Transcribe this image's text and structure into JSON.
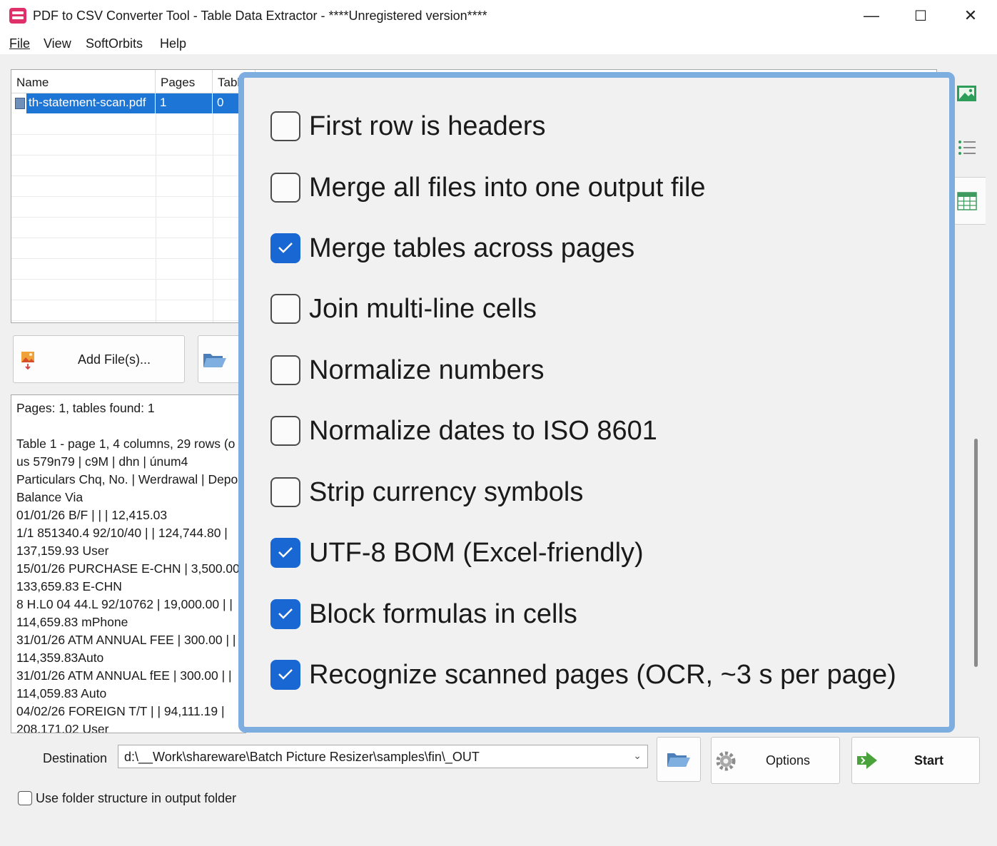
{
  "window": {
    "title": "PDF to CSV Converter Tool - Table Data Extractor - ****Unregistered version****",
    "minimize": "—",
    "maximize": "☐",
    "close": "✕"
  },
  "menu": [
    "File",
    "View",
    "SoftOrbits",
    "Help"
  ],
  "file_list": {
    "columns": [
      "Name",
      "Pages",
      "Tabl"
    ],
    "rows": [
      {
        "name": "th-statement-scan.pdf",
        "pages": "1",
        "tables": "0"
      }
    ]
  },
  "buttons": {
    "add_files": "Add File(s)...",
    "options": "Options",
    "start": "Start"
  },
  "log": {
    "lines": [
      "Pages: 1, tables found: 1",
      "",
      "Table 1 - page 1, 4 columns, 29 rows (o",
      "us 579n79 | c9M | dhn | únum4",
      "Particulars Chq, No. | Werdrawal | Depos",
      "Balance Via",
      "01/01/26 B/F |  |  | 12,415.03",
      "1/1 851340.4 92/10/40 |  | 124,744.80 |",
      "137,159.93 User",
      "15/01/26 PURCHASE E-CHN | 3,500.00",
      "133,659.83 E-CHN",
      "8 H.L0 04 44.L 92/10762 | 19,000.00 |  |",
      "114,659.83 mPhone",
      "31/01/26 ATM ANNUAL FEE | 300.00 |  |",
      "114,359.83Auto",
      "31/01/26 ATM ANNUAL fEE | 300.00 |  |",
      "114,059.83 Auto",
      "04/02/26 FOREIGN T/T |  | 94,111.19 |",
      "208,171.02 User"
    ]
  },
  "destination": {
    "label": "Destination",
    "value": "d:\\__Work\\shareware\\Batch Picture Resizer\\samples\\fin\\_OUT"
  },
  "folder_structure": {
    "label": "Use folder structure in output folder",
    "checked": false
  },
  "options": [
    {
      "label": "First row is headers",
      "checked": false
    },
    {
      "label": "Merge all files into one output file",
      "checked": false
    },
    {
      "label": "Merge tables across pages",
      "checked": true
    },
    {
      "label": "Join multi-line cells",
      "checked": false
    },
    {
      "label": "Normalize numbers",
      "checked": false
    },
    {
      "label": "Normalize dates to ISO 8601",
      "checked": false
    },
    {
      "label": "Strip currency symbols",
      "checked": false
    },
    {
      "label": "UTF-8 BOM (Excel-friendly)",
      "checked": true
    },
    {
      "label": "Block formulas in cells",
      "checked": true
    },
    {
      "label": "Recognize scanned pages (OCR, ~3 s per page)",
      "checked": true
    }
  ],
  "icons": {
    "app": "app-icon",
    "preview": "image-preview-icon",
    "list": "list-view-icon",
    "table": "table-view-icon",
    "add": "add-image-icon",
    "folder": "folder-open-icon",
    "gear": "gear-icon",
    "start": "start-arrow-icon"
  },
  "colors": {
    "accent": "#1967d2",
    "selection": "#1d76d6",
    "overlay_border": "#7eaee0"
  }
}
